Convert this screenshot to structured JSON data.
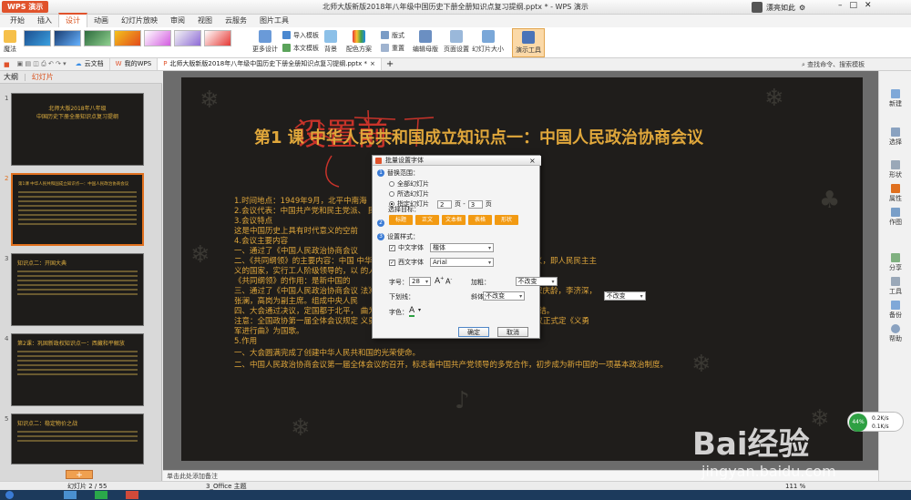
{
  "app": {
    "name": "WPS 演示",
    "doc_title": "北师大版新版2018年八年级中国历史下册全册知识点复习提纲.pptx * - WPS 演示"
  },
  "user": {
    "name": "漂亮如此"
  },
  "menu_tabs": [
    "开始",
    "插入",
    "设计",
    "动画",
    "幻灯片放映",
    "审阅",
    "视图",
    "云服务",
    "图片工具"
  ],
  "ribbon": {
    "magic": "魔法",
    "more_design": "更多设计",
    "import_template": "导入模板",
    "text_template": "本文模板",
    "background": "背景",
    "color_scheme": "配色方案",
    "format": "版式",
    "reset": "重置",
    "edit_master": "编辑母版",
    "page_setup": "页面设置",
    "slide_size": "幻灯片大小",
    "presenter_tools": "演示工具"
  },
  "doc_tabs": [
    {
      "label": "云文档"
    },
    {
      "label": "我的WPS"
    },
    {
      "label": "北师大版新版2018年八年级中国历史下册全册知识点复习提纲.pptx *"
    }
  ],
  "search": {
    "placeholder": "查找命令、搜索模板"
  },
  "panel": {
    "tab_outline": "大纲",
    "tab_slides": "幻灯片"
  },
  "thumbs": [
    {
      "num": "1",
      "title": "北师大版2018年八年级\n中国历史下册全册知识点复习提纲"
    },
    {
      "num": "2",
      "title": "第1课 中华人民共和国成立知识点一：中国人民政治协商会议"
    },
    {
      "num": "3",
      "title": "知识点二：开国大典"
    },
    {
      "num": "4",
      "title": "第2课：巩固新政权知识点一：西藏和平解放"
    },
    {
      "num": "5",
      "title": "知识点二：稳定物价之战"
    }
  ],
  "slide": {
    "handwriting": "设置前",
    "title": "第1 课  中华人民共和国成立知识点一：中国人民政治协商会议",
    "lines": [
      "1.时间地点：1949年9月，北平中南海",
      "2.会议代表：中国共产党和民主党派、                                                                                        民族以及国外华侨。",
      "3.会议特点",
      "这是中国历史上具有时代意义的空前",
      "4.会议主要内容",
      "一、通过了《中国人民政治协商会议",
      "二、《共同纲领》的主要内容：中国                                                    中华人民共和国的成立，中华人民共和国为新民主主义，即人民民主主",
      "义的国家，实行工人阶级领导的，以                                                    的人民民主专政。",
      "     《共同纲领》的作用：是新中国的",
      "三、通过了《中国人民政治协商会议                                                    法》，选举毛泽东为中央人民政府，朱德，刘少奇，宋庆龄，李济深，",
      "张澜，高岗为副主席。组成中央人民",
      "四、大会通过决议，定国都于北平，                                                    曲为国歌，五星红旗为国旗，象征中国革命人民大团结。",
      "注意：全国政协第一届全体会议规定                                                    义勇军进行曲为国歌。”1982年，全国人大五届次会议正式定《义勇",
      "军进行曲》为国歌。",
      "5.作用",
      "一、大会圆满完成了创建中华人民共和国的光荣使命。",
      "二、中国人民政治协商会议第一届全体会议的召开，标志着中国共产党领导的多党合作，初步成为新中国的一项基本政治制度。"
    ]
  },
  "dialog": {
    "title": "批量设置字体",
    "close": "×",
    "sec1": "替换范围：",
    "opt_all": "全部幻灯片",
    "opt_selected": "所选幻灯片",
    "opt_specified": "指定幻灯片",
    "from": "2",
    "page_to": "页 -",
    "to": "3",
    "page_end": "页",
    "sec2": "选择目标：",
    "targets": [
      "标题",
      "正文",
      "文本框",
      "表格",
      "形状"
    ],
    "sec3": "设置样式：",
    "cn_font_label": "中文字体",
    "cn_font": "楷体",
    "en_font_label": "西文字体",
    "en_font": "Arial",
    "size_label": "字号：",
    "size": "28",
    "bold_label": "加粗：",
    "bold": "不改变",
    "underline_label": "下划线：",
    "underline": "不改变",
    "italic_label": "斜体：",
    "italic": "不改变",
    "color_label": "字色：",
    "ok": "确定",
    "cancel": "取消"
  },
  "rail": [
    "新建",
    "选择",
    "形状",
    "属性",
    "作图",
    "分享",
    "工具",
    "备份",
    "帮助"
  ],
  "notes": {
    "placeholder": "单击此处添加备注"
  },
  "status": {
    "slide": "幻灯片 2 / 55",
    "theme": "3_Office 主题",
    "zoom": "111 %"
  },
  "net": {
    "percent": "44%",
    "up": "0.2K/s",
    "down": "0.1K/s"
  },
  "watermark": {
    "brand": "Bai经验",
    "url": "jingyan.baidu.com"
  }
}
